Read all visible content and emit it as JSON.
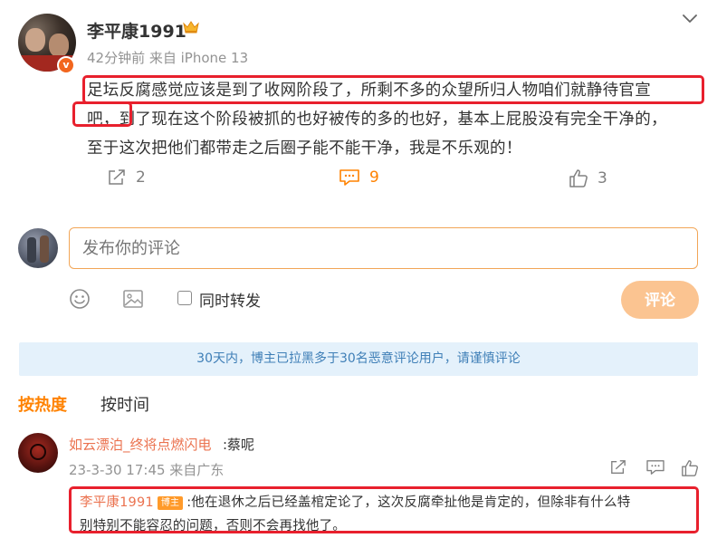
{
  "post": {
    "author": "李平康1991",
    "meta": "42分钟前 来自 iPhone 13",
    "avatar_badge": "v",
    "text_lines": [
      "足坛反腐感觉应该是到了收网阶段了，所剩不多的众望所归人物咱们就静待官宣",
      "吧，到了现在这个阶段被抓的也好被传的多的也好，基本上屁股没有完全干净的，",
      "至于这次把他们都带走之后圈子能不能干净，我是不乐观的！"
    ],
    "actions": {
      "repost_count": "2",
      "comment_count": "9",
      "like_count": "3"
    }
  },
  "composer": {
    "placeholder": "发布你的评论",
    "repost_label": "同时转发",
    "submit_label": "评论"
  },
  "notice": "30天内，博主已拉黑多于30名恶意评论用户，请谨慎评论",
  "sort": {
    "hot_label": "按热度",
    "time_label": "按时间"
  },
  "comment": {
    "user": "如云漂泊_终将点燃闪电",
    "text": ":蔡呢",
    "meta": "23-3-30 17:45 来自广东",
    "reply": {
      "user": "李平康1991",
      "badge": "博主",
      "text_lines": [
        ":他在退休之后已经盖棺定论了，这次反腐牵扯他是肯定的，但除非有什么特",
        "别特别不能容忍的问题，否则不会再找他了。"
      ]
    }
  },
  "colors": {
    "accent_orange": "#ff8200",
    "username_orange": "#eb7350",
    "highlight_red": "#e8202d",
    "notice_bg": "#e4f1fb",
    "notice_text": "#3f7fb7"
  }
}
